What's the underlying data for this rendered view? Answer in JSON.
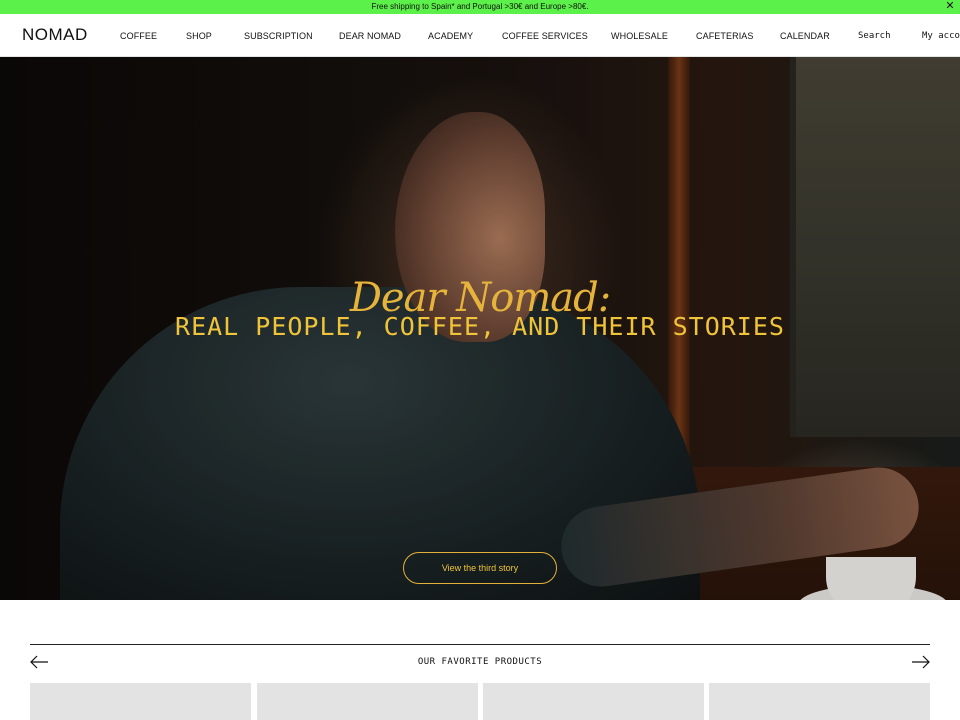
{
  "announcement": {
    "text": "Free shipping to Spain* and Portugal >30€ and Europe >80€.",
    "close": "✕"
  },
  "header": {
    "logo": "NOMAD",
    "nav": [
      "COFFEE",
      "SHOP",
      "SUBSCRIPTION",
      "DEAR NOMAD",
      "ACADEMY",
      "COFFEE SERVICES",
      "WHOLESALE",
      "CAFETERIAS",
      "CALENDAR"
    ],
    "search": "Search",
    "account": "My account"
  },
  "hero": {
    "script": "Dear Nomad:",
    "title": "REAL PEOPLE, COFFEE, AND THEIR STORIES",
    "button": "View the third story"
  },
  "products": {
    "title": "OUR FAVORITE PRODUCTS",
    "prev_icon": "arrow-left-icon",
    "next_icon": "arrow-right-icon"
  },
  "colors": {
    "announcement_bg": "#5cf04a",
    "hero_accent": "#f0c43a"
  }
}
